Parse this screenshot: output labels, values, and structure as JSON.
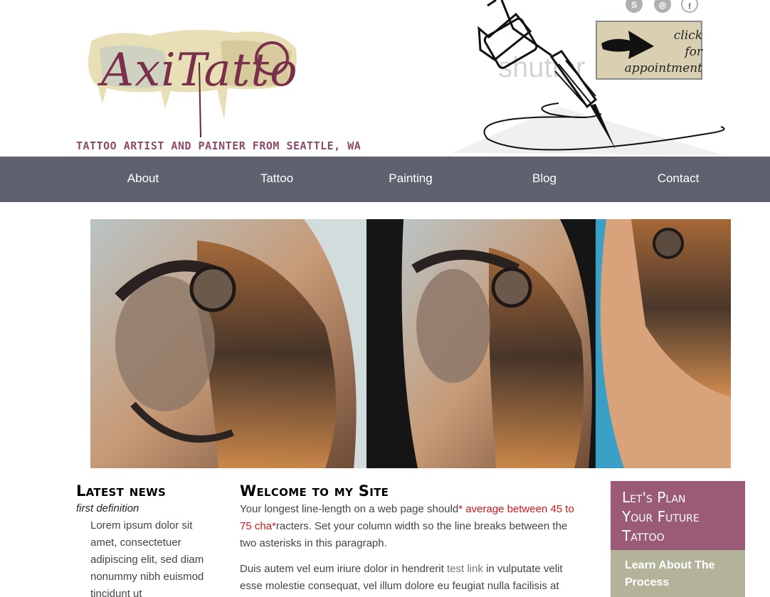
{
  "header": {
    "logo_text": "AxiTattoo",
    "tagline": "TATTOO ARTIST AND PAINTER FROM SEATTLE, WA",
    "watermark": "shutter",
    "social": [
      {
        "icon": "skype-icon",
        "glyph": "S"
      },
      {
        "icon": "instagram-icon",
        "glyph": "◎"
      },
      {
        "icon": "facebook-icon",
        "glyph": "f"
      }
    ],
    "appointment": {
      "line1": "click",
      "line2": "for",
      "line3": "appointment"
    }
  },
  "nav": {
    "items": [
      "About",
      "Tattoo",
      "Painting",
      "Blog",
      "Contact"
    ],
    "background": "#5e626e"
  },
  "news": {
    "heading": "Latest news",
    "definition_term": "first definition",
    "definition_text": "Lorem ipsum dolor sit amet, consectetuer adipiscing elit, sed diam nonummy nibh euismod tincidunt ut"
  },
  "welcome": {
    "heading": "Welcome to my Site",
    "p1_before": "Your longest line-length on a web page should",
    "p1_red": "* average between 45 to 75 cha*",
    "p1_after": "racters. Set your column width so the line breaks between the two asterisks in this paragraph.",
    "p2_before": "Duis autem vel eum iriure dolor in hendrerit ",
    "p2_link": "test link",
    "p2_after": " in vulputate velit esse molestie consequat, vel illum dolore eu feugiat nulla facilisis at"
  },
  "sidebar": {
    "cta_lines": [
      "Let's Plan",
      "Your Future",
      "Tattoo"
    ],
    "cta_color": "#9b5b76",
    "learn_lines": [
      "Learn About The",
      "Process"
    ],
    "learn_color": "#b3b399"
  }
}
